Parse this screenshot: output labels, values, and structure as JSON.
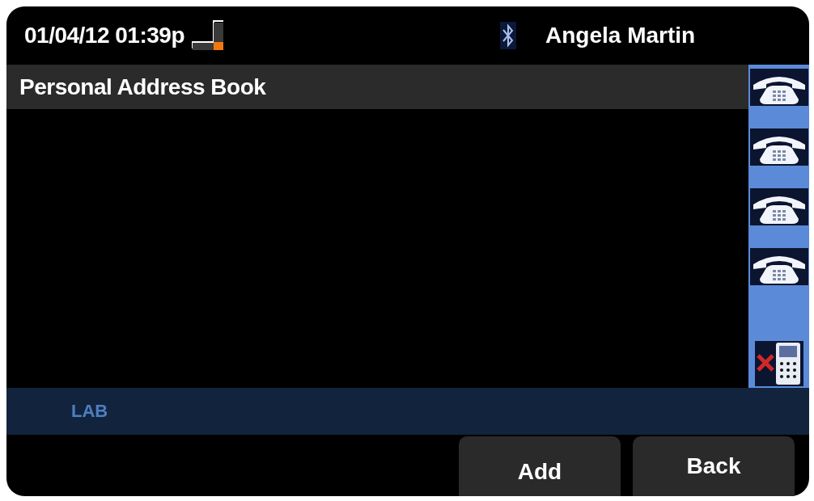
{
  "header": {
    "datetime": "01/04/12 01:39p",
    "user": "Angela Martin"
  },
  "title": "Personal Address Book",
  "line_keys": [
    {
      "kind": "phone"
    },
    {
      "kind": "phone"
    },
    {
      "kind": "phone"
    },
    {
      "kind": "phone"
    },
    {
      "kind": "phone-off"
    }
  ],
  "status_bar": {
    "label": "LAB"
  },
  "softkeys": [
    "Add",
    "Back"
  ]
}
